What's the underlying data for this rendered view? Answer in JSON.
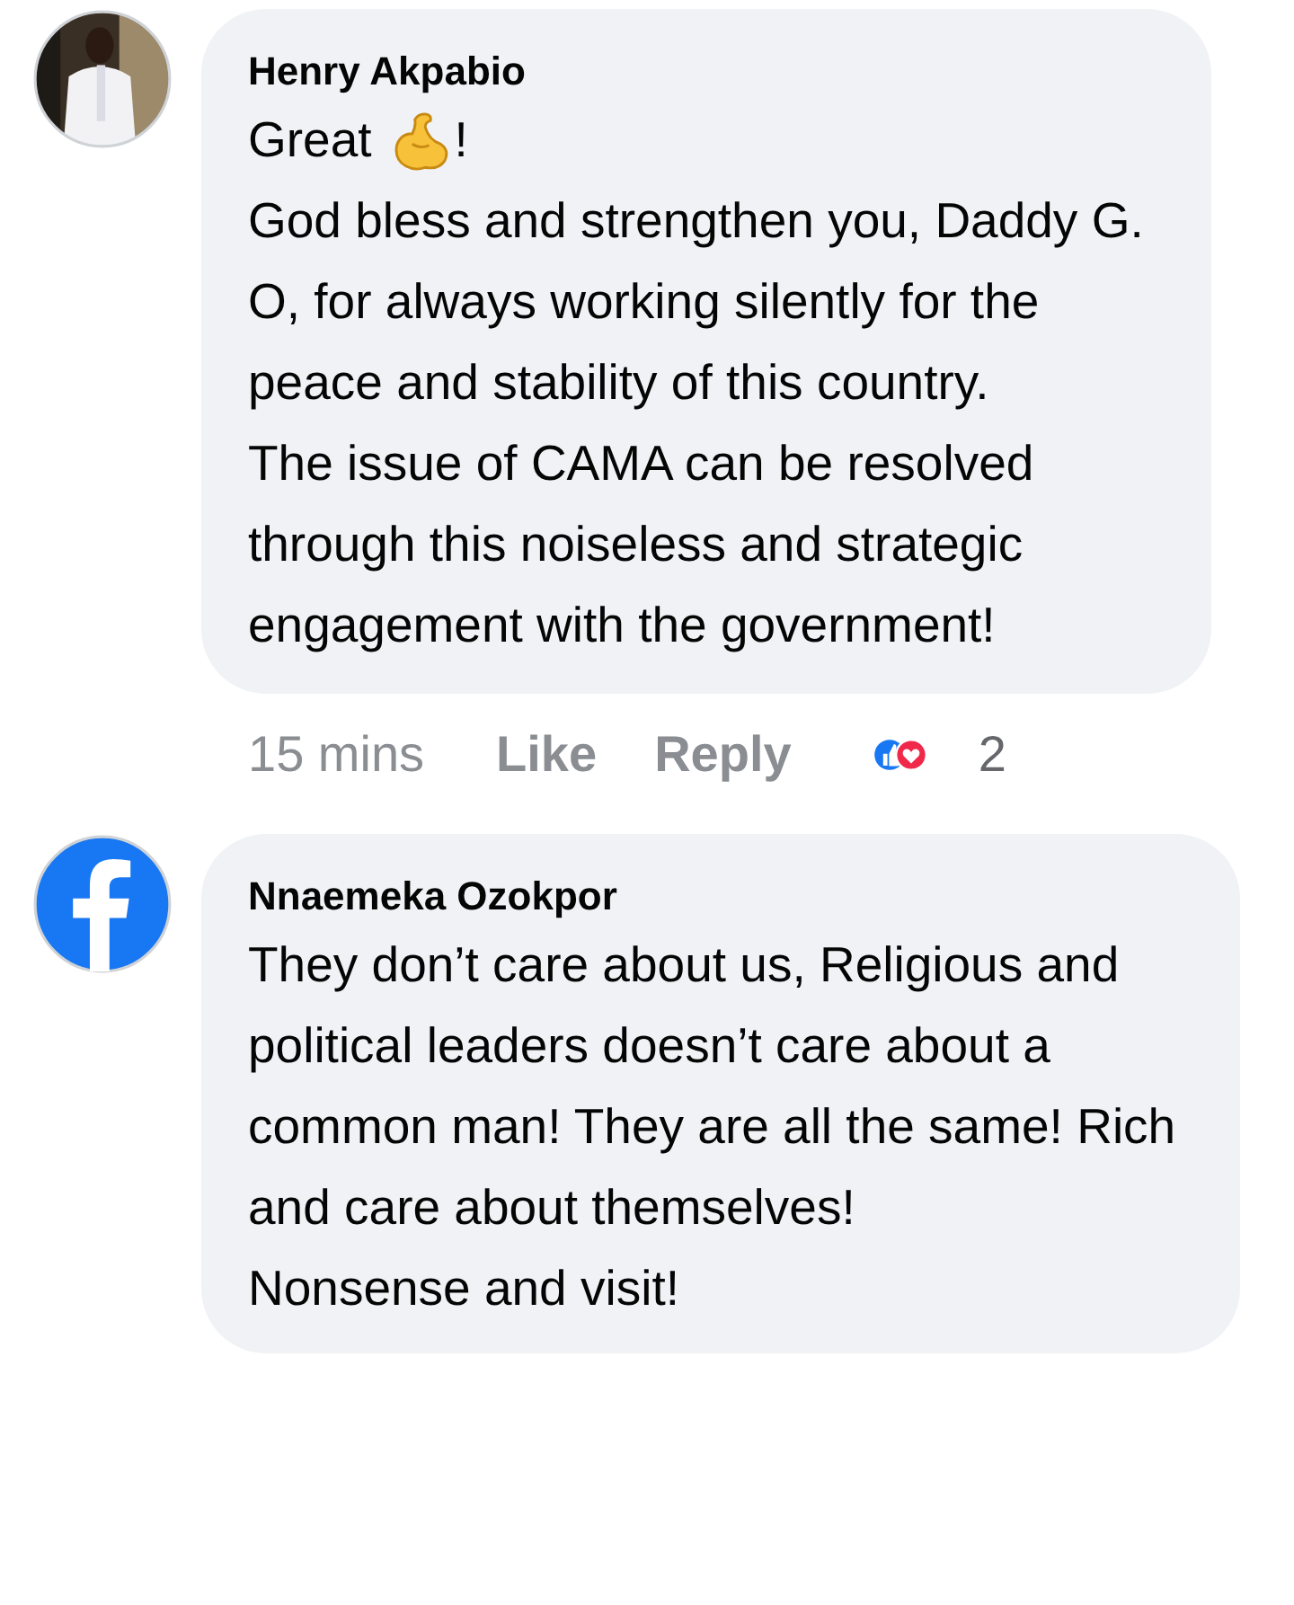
{
  "comments": [
    {
      "author": "Henry Akpabio",
      "avatar": {
        "kind": "picture"
      },
      "paragraphs": [
        {
          "kind": "emoji",
          "before": "Great",
          "after": "!"
        },
        {
          "kind": "text",
          "text": "God bless and strengthen you, Daddy G. O, for always working silently for the peace and stability of this country."
        },
        {
          "kind": "text",
          "text": "The issue of CAMA can be resolved through this noiseless and strategic engagement with the government!"
        }
      ],
      "time": "15 mins",
      "actions": [
        "Like",
        "Reply"
      ],
      "reaction_count": "2"
    },
    {
      "author": "Nnaemeka Ozokpor",
      "avatar": {
        "kind": "logo"
      },
      "paragraphs": [
        {
          "kind": "text",
          "text": "They don’t care about us, Religious and political leaders doesn’t care about a common man! They are all the same! Rich and care about themselves!"
        },
        {
          "kind": "text",
          "text": "Nonsense and visit!"
        }
      ]
    }
  ]
}
